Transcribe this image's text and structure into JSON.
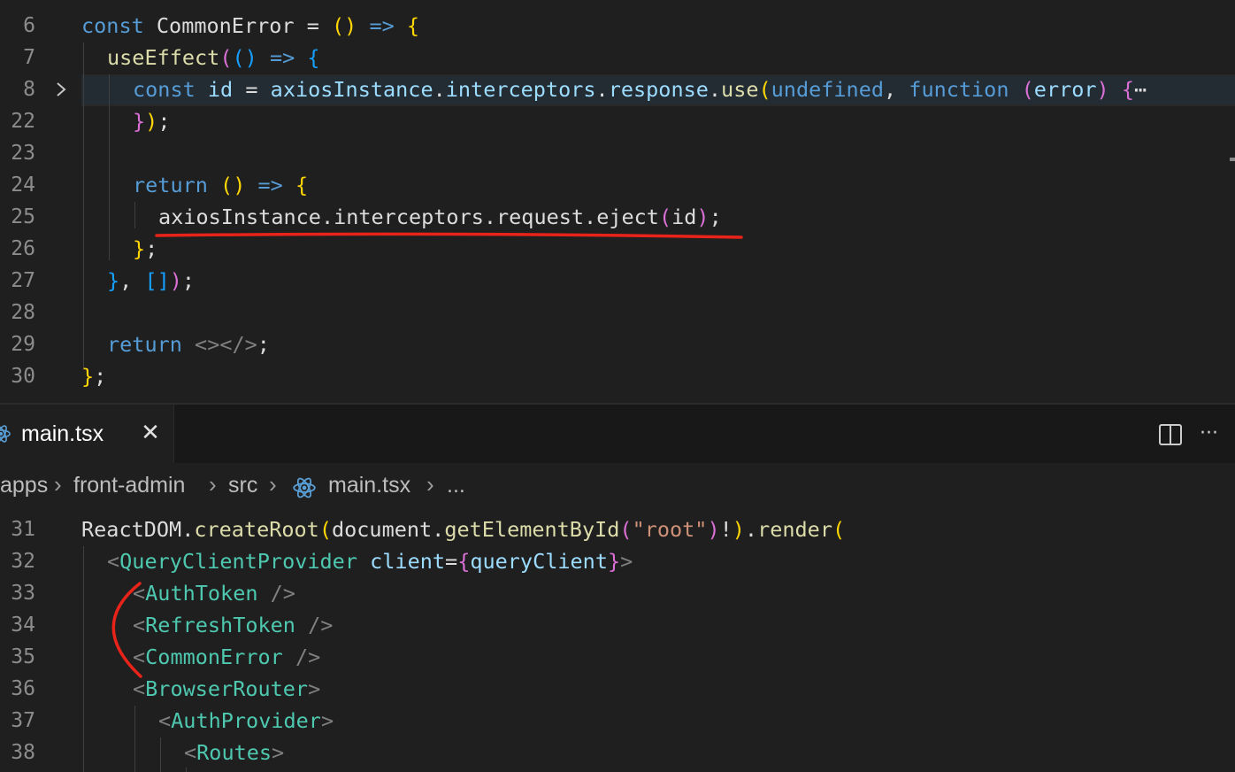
{
  "top_editor": {
    "lines": [
      {
        "n": "6"
      },
      {
        "n": "7"
      },
      {
        "n": "8"
      },
      {
        "n": "22"
      },
      {
        "n": "23"
      },
      {
        "n": "24"
      },
      {
        "n": "25"
      },
      {
        "n": "26"
      },
      {
        "n": "27"
      },
      {
        "n": "28"
      },
      {
        "n": "29"
      },
      {
        "n": "30"
      }
    ],
    "code": {
      "l6": [
        "const",
        "CommonError",
        "=",
        "()",
        "=>",
        "{"
      ],
      "l7": [
        "useEffect",
        "(",
        "()",
        "=>",
        "{"
      ],
      "l8": [
        "const",
        "id",
        "=",
        "axiosInstance",
        ".",
        "interceptors",
        ".",
        "response",
        ".",
        "use",
        "(",
        "undefined",
        ", ",
        "function",
        "(",
        "error",
        ")",
        "{",
        "⋯"
      ],
      "l22": [
        "}",
        ")",
        ";"
      ],
      "l24": [
        "return",
        "()",
        "=>",
        "{"
      ],
      "l25": [
        "axiosInstance",
        ".interceptors.request.",
        "eject",
        "(",
        "id",
        ")",
        ";"
      ],
      "l26": [
        "}",
        ";"
      ],
      "l27": [
        "}",
        ", ",
        "[]",
        ")",
        ";"
      ],
      "l29": [
        "return",
        "<></>",
        ";"
      ],
      "l30": [
        "}",
        ";"
      ]
    }
  },
  "tab": {
    "label": "main.tsx",
    "close": "✕",
    "more": "···"
  },
  "breadcrumb": {
    "items": [
      "apps",
      "front-admin",
      "src",
      "main.tsx",
      "..."
    ],
    "sep": "›"
  },
  "bottom_editor": {
    "lines": [
      {
        "n": "31"
      },
      {
        "n": "32"
      },
      {
        "n": "33"
      },
      {
        "n": "34"
      },
      {
        "n": "35"
      },
      {
        "n": "36"
      },
      {
        "n": "37"
      },
      {
        "n": "38"
      }
    ],
    "code": {
      "l31": [
        "ReactDOM",
        ".",
        "createRoot",
        "(",
        "document",
        ".",
        "getElementById",
        "(",
        "\"root\"",
        ")",
        "!",
        ")",
        ".",
        "render",
        "("
      ],
      "l32": [
        "<",
        "QueryClientProvider",
        "client",
        "=",
        "{",
        "queryClient",
        "}",
        ">"
      ],
      "l33": [
        "<",
        "AuthToken",
        "/>"
      ],
      "l34": [
        "<",
        "RefreshToken",
        "/>"
      ],
      "l35": [
        "<",
        "CommonError",
        "/>"
      ],
      "l36": [
        "<",
        "BrowserRouter",
        ">"
      ],
      "l37": [
        "<",
        "AuthProvider",
        ">"
      ],
      "l38": [
        "<",
        "Routes",
        ">"
      ]
    }
  },
  "colors": {
    "background": "#1f1f1f",
    "keyword": "#569cd6",
    "function": "#dcdcaa",
    "variable": "#9cdcfe",
    "string": "#ce9178",
    "component": "#4ec9b0",
    "annotation": "#e8231a"
  },
  "icons": [
    "chevron-right-icon",
    "react-icon",
    "close-icon",
    "split-editor-icon",
    "more-icon"
  ]
}
